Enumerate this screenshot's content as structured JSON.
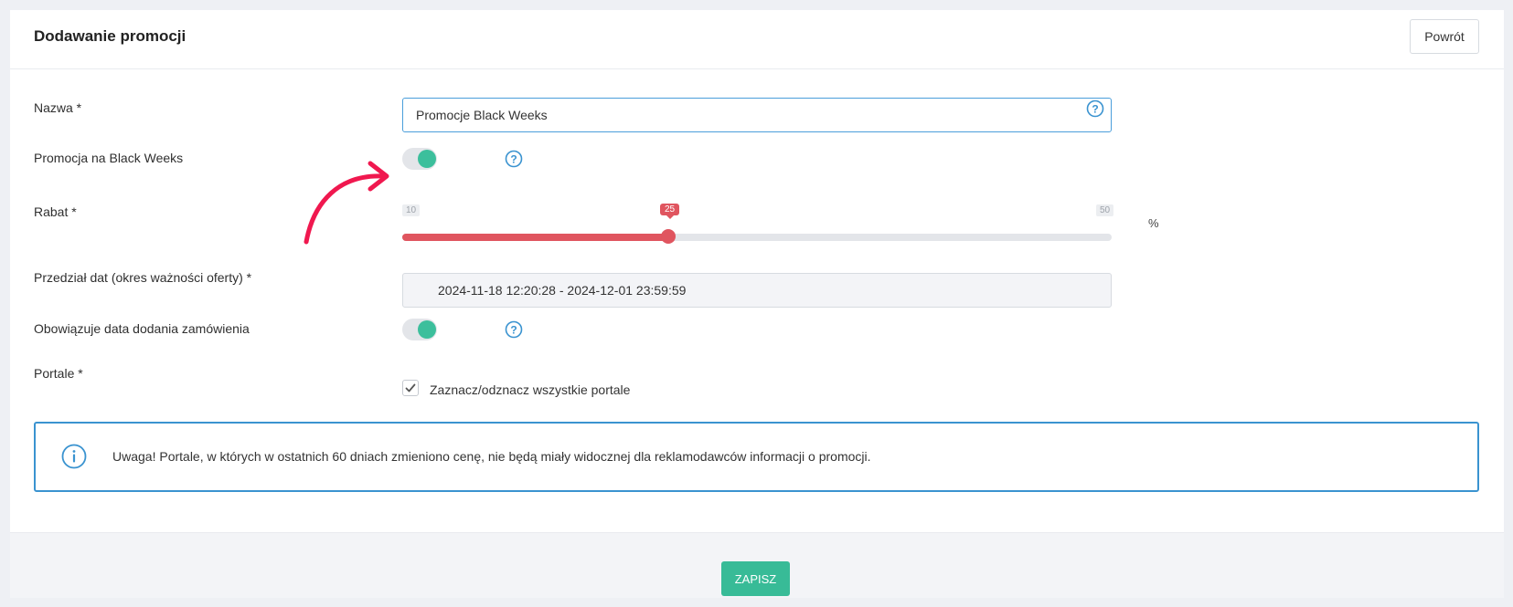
{
  "header": {
    "title": "Dodawanie promocji",
    "back_label": "Powrót"
  },
  "form": {
    "name": {
      "label": "Nazwa *",
      "value": "Promocje Black Weeks"
    },
    "black_weeks": {
      "label": "Promocja na Black Weeks",
      "enabled": true
    },
    "discount": {
      "label": "Rabat *",
      "min": "10",
      "max": "50",
      "value": "25",
      "unit": "%"
    },
    "date_range": {
      "label": "Przedział dat (okres ważności oferty) *",
      "value": "2024-11-18 12:20:28 - 2024-12-01 23:59:59"
    },
    "order_date": {
      "label": "Obowiązuje data dodania zamówienia",
      "enabled": true
    },
    "portals": {
      "label": "Portale *",
      "checkbox_label": "Zaznacz/odznacz wszystkie portale",
      "checked": true
    }
  },
  "alert": {
    "text": "Uwaga! Portale, w których w ostatnich 60 dniach zmieniono cenę, nie będą miały widocznej dla reklamodawców informacji o promocji."
  },
  "footer": {
    "save_label": "ZAPISZ"
  },
  "colors": {
    "accent_green": "#38bb97",
    "slider_red": "#e0555f",
    "info_blue": "#3a93d0",
    "annotation_arrow": "#f0184f"
  },
  "icons": {
    "help": "question-circle-icon",
    "info": "info-circle-icon",
    "check": "checkmark-icon",
    "annotation": "curved-arrow-icon"
  }
}
